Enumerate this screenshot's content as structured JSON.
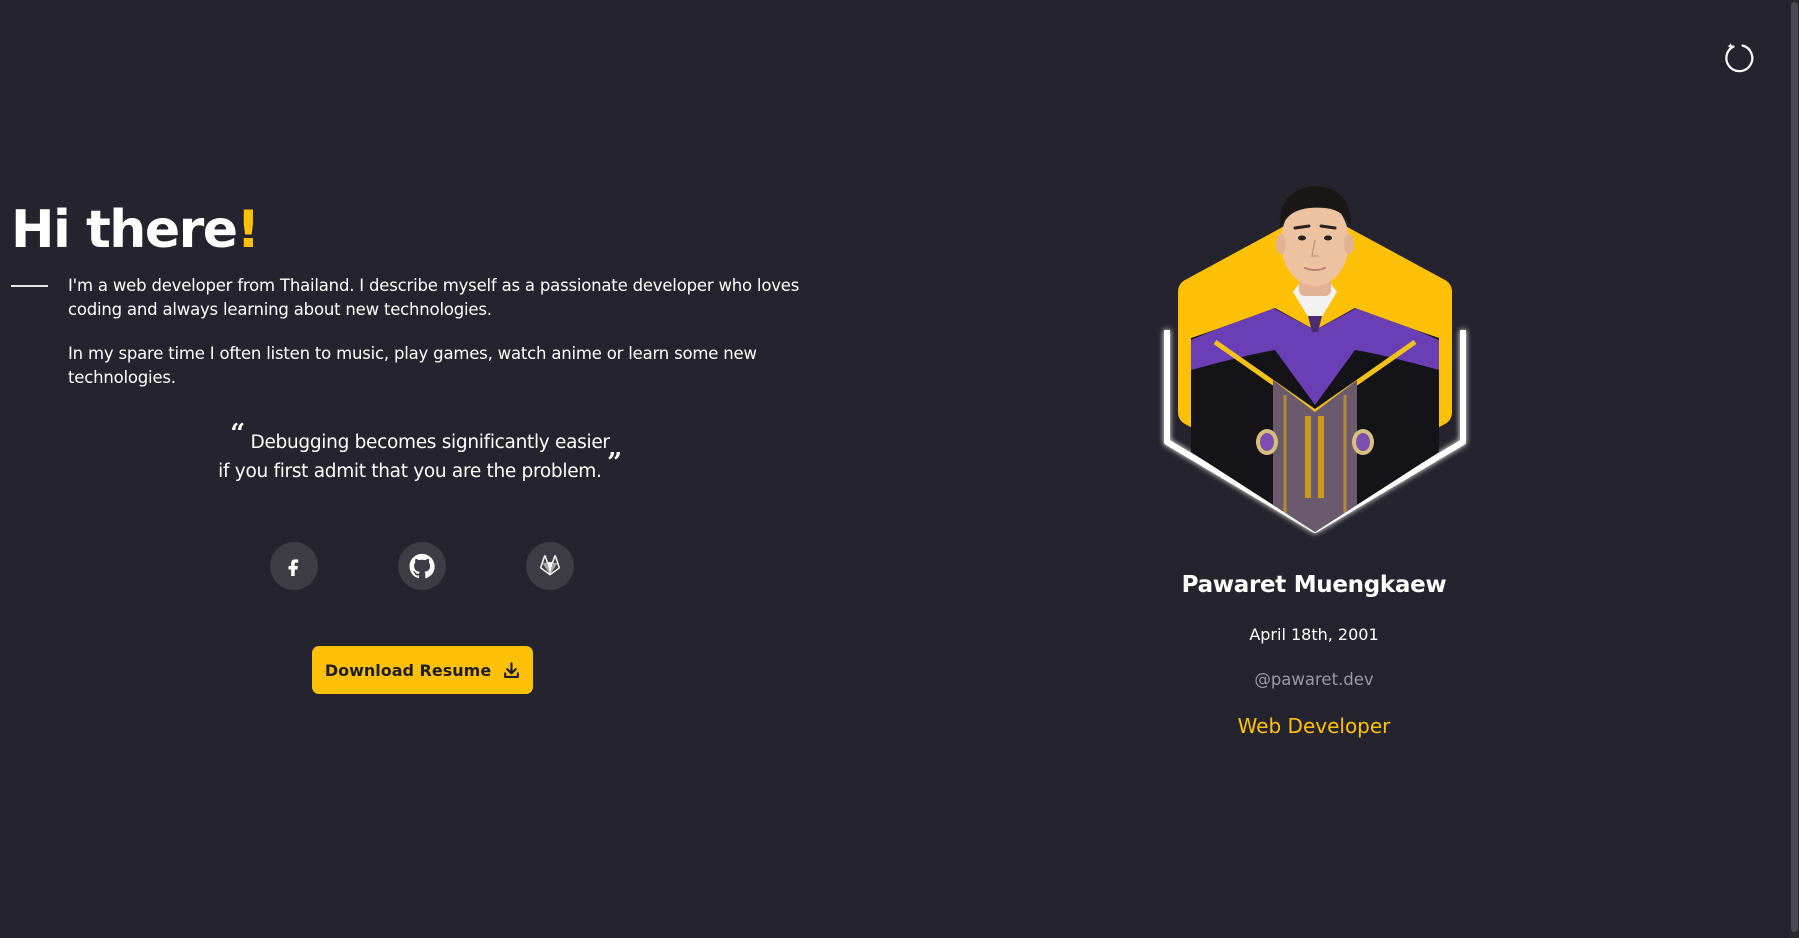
{
  "hero": {
    "title": "Hi there",
    "title_accent": "!"
  },
  "bio": {
    "paragraphs": [
      "I'm a web developer from Thailand. I describe myself as a passionate developer who loves coding and always learning about new technologies.",
      "In my spare time I often listen to music, play games, watch anime or learn some new technologies."
    ]
  },
  "quote": {
    "open_mark": "“",
    "line1": "Debugging becomes significantly easier",
    "line2": "if you first admit that you are the problem.",
    "close_mark": "”"
  },
  "social": {
    "links": [
      {
        "name": "facebook",
        "icon": "facebook-icon"
      },
      {
        "name": "github",
        "icon": "github-icon"
      },
      {
        "name": "gitlab",
        "icon": "gitlab-icon"
      }
    ]
  },
  "actions": {
    "download_label": "Download Resume",
    "download_icon": "download-icon"
  },
  "profile": {
    "name": "Pawaret Muengkaew",
    "birthday": "April 18th, 2001",
    "handle": "@pawaret.dev",
    "role": "Web Developer"
  },
  "theme": {
    "toggle_icon": "theme-toggle-icon"
  },
  "colors": {
    "background": "#25232d",
    "accent": "#ffc107",
    "text": "#ffffff",
    "muted": "#9a98a3",
    "social_bg": "#3e3c45"
  }
}
